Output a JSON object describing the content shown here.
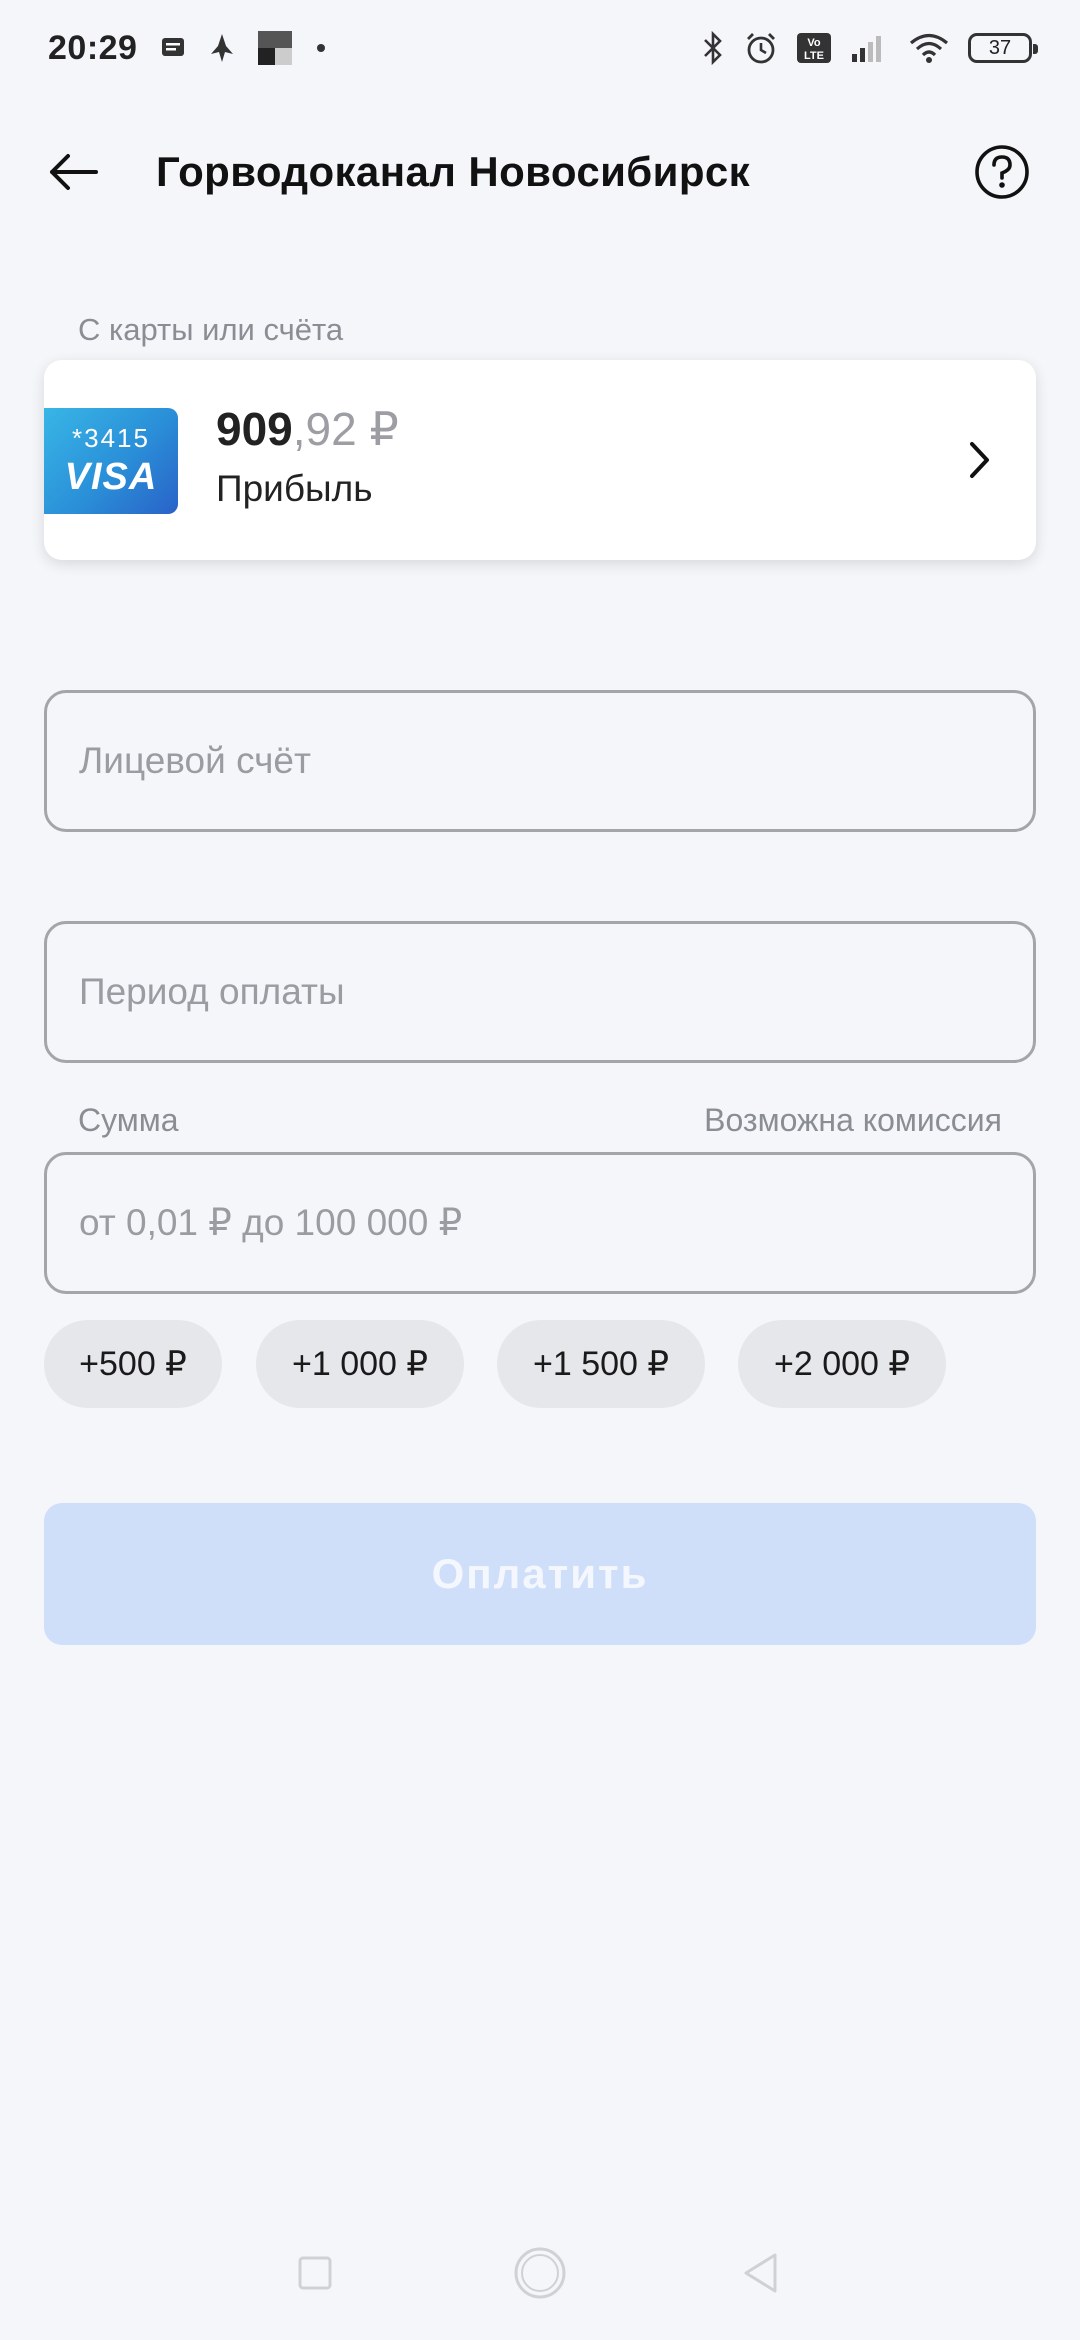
{
  "status_bar": {
    "time": "20:29",
    "battery": "37",
    "left_icons": [
      "message-icon",
      "rocket-icon",
      "app-tile-icon",
      "dot-icon"
    ],
    "right_icons": [
      "bluetooth-icon",
      "alarm-icon",
      "volte-icon",
      "signal-icon",
      "wifi-icon",
      "battery-icon"
    ]
  },
  "header": {
    "title": "Горводоканал Новосибирск",
    "back_icon": "arrow-left-icon",
    "help_icon": "question-circle-icon"
  },
  "source": {
    "label": "С карты или счёта",
    "card": {
      "masked_number": "*3415",
      "brand": "VISA",
      "balance_whole": "909",
      "balance_fraction": ",92 ₽",
      "name": "Прибыль",
      "chevron_icon": "chevron-right-icon"
    }
  },
  "form": {
    "account_placeholder": "Лицевой счёт",
    "period_placeholder": "Период оплаты",
    "sum_label": "Сумма",
    "commission_label": "Возможна комиссия",
    "amount_placeholder": "от 0,01 ₽ до 100 000 ₽"
  },
  "chips": [
    "+500 ₽",
    "+1 000 ₽",
    "+1 500 ₽",
    "+2 000 ₽"
  ],
  "pay_button": {
    "label": "Оплатить",
    "enabled": false
  },
  "nav_bar": {
    "items": [
      "recents-square-icon",
      "home-circle-icon",
      "back-triangle-icon"
    ]
  },
  "colors": {
    "background": "#f4f6fa",
    "pay_button_disabled": "#cfdffa",
    "chip": "#e5e7eb",
    "visa_gradient_start": "#38b6e6",
    "visa_gradient_end": "#2962c8"
  }
}
